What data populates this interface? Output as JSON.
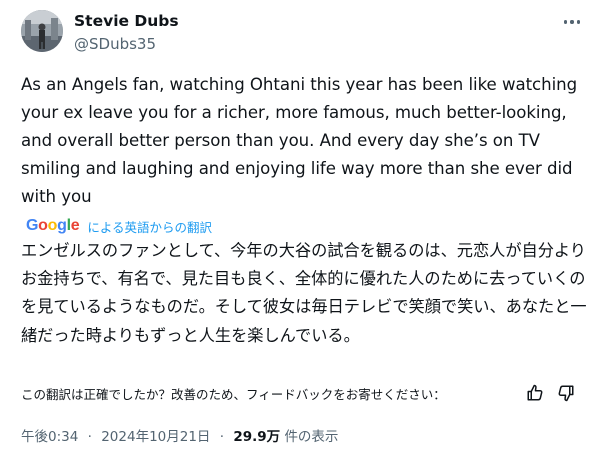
{
  "author": {
    "display_name": "Stevie Dubs",
    "handle": "@SDubs35"
  },
  "tweet": {
    "text": "As an Angels fan, watching Ohtani this year has been like watching your ex leave you for a richer, more famous, much better-looking, and overall better person than you. And every day she’s on TV smiling and laughing and enjoying life way more than she ever did with you"
  },
  "translation": {
    "provider_logo": "Google",
    "label": "による英語からの翻訳",
    "text": "エンゼルスのファンとして、今年の大谷の試合を観るのは、元恋人が自分よりお金持ちで、有名で、見た目も良く、全体的に優れた人のために去っていくのを見ているようなものだ。そして彼女は毎日テレビで笑顔で笑い、あなたと一緒だった時よりもずっと人生を楽しんでいる。",
    "feedback_prompt": "この翻訳は正確でしたか？改善のため、フィードバックをお寄せください："
  },
  "meta": {
    "time": "午後0:34",
    "date": "2024年10月21日",
    "views_count": "29.9万",
    "views_label": "件の表示",
    "separator": "·"
  },
  "icons": {
    "more": "more-horizontal-icon",
    "thumb_up": "thumbs-up-icon",
    "thumb_down": "thumbs-down-icon"
  },
  "colors": {
    "text": "#0f1419",
    "secondary": "#536471",
    "link": "#1d9bf0",
    "google_blue": "#4285F4",
    "google_red": "#EA4335",
    "google_yellow": "#FBBC05",
    "google_green": "#34A853"
  }
}
